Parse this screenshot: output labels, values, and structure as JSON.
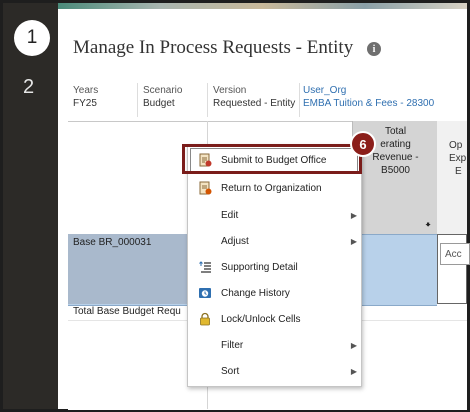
{
  "steps": {
    "current": "1",
    "next": "2"
  },
  "page": {
    "title": "Manage In Process Requests - Entity",
    "info_icon": "i"
  },
  "pov": [
    {
      "label": "Years",
      "value": "FY25"
    },
    {
      "label": "Scenario",
      "value": "Budget"
    },
    {
      "label": "Version",
      "value": "Requested - Entity"
    },
    {
      "label": "User_Org",
      "value": "EMBA Tuition & Fees - 28300"
    }
  ],
  "grid": {
    "col_header_1": [
      "Total",
      "erating",
      "Revenue -",
      "B5000"
    ],
    "col_header_2": [
      "Op",
      "Exp",
      "E"
    ],
    "rows": [
      "Base BR_000031",
      "Total Base Budget Requ"
    ],
    "cell_input": "Acc"
  },
  "context_menu": {
    "items": [
      {
        "label": "Submit to Budget Office",
        "icon": "submit-doc-icon",
        "submenu": false
      },
      {
        "label": "Return to Organization",
        "icon": "return-doc-icon",
        "submenu": false
      },
      {
        "label": "Edit",
        "icon": "",
        "submenu": true
      },
      {
        "label": "Adjust",
        "icon": "",
        "submenu": true
      },
      {
        "label": "Supporting Detail",
        "icon": "supporting-detail-icon",
        "submenu": false
      },
      {
        "label": "Change History",
        "icon": "change-history-icon",
        "submenu": false
      },
      {
        "label": "Lock/Unlock Cells",
        "icon": "lock-icon",
        "submenu": false
      },
      {
        "label": "Filter",
        "icon": "",
        "submenu": true
      },
      {
        "label": "Sort",
        "icon": "",
        "submenu": true
      }
    ]
  },
  "callout": {
    "number": "6"
  },
  "colors": {
    "rail": "#2c2a27",
    "highlight": "#7a1c1a",
    "badge": "#8b1e1a",
    "selected_row": "#b8d1ea",
    "link": "#2f6fb0"
  }
}
